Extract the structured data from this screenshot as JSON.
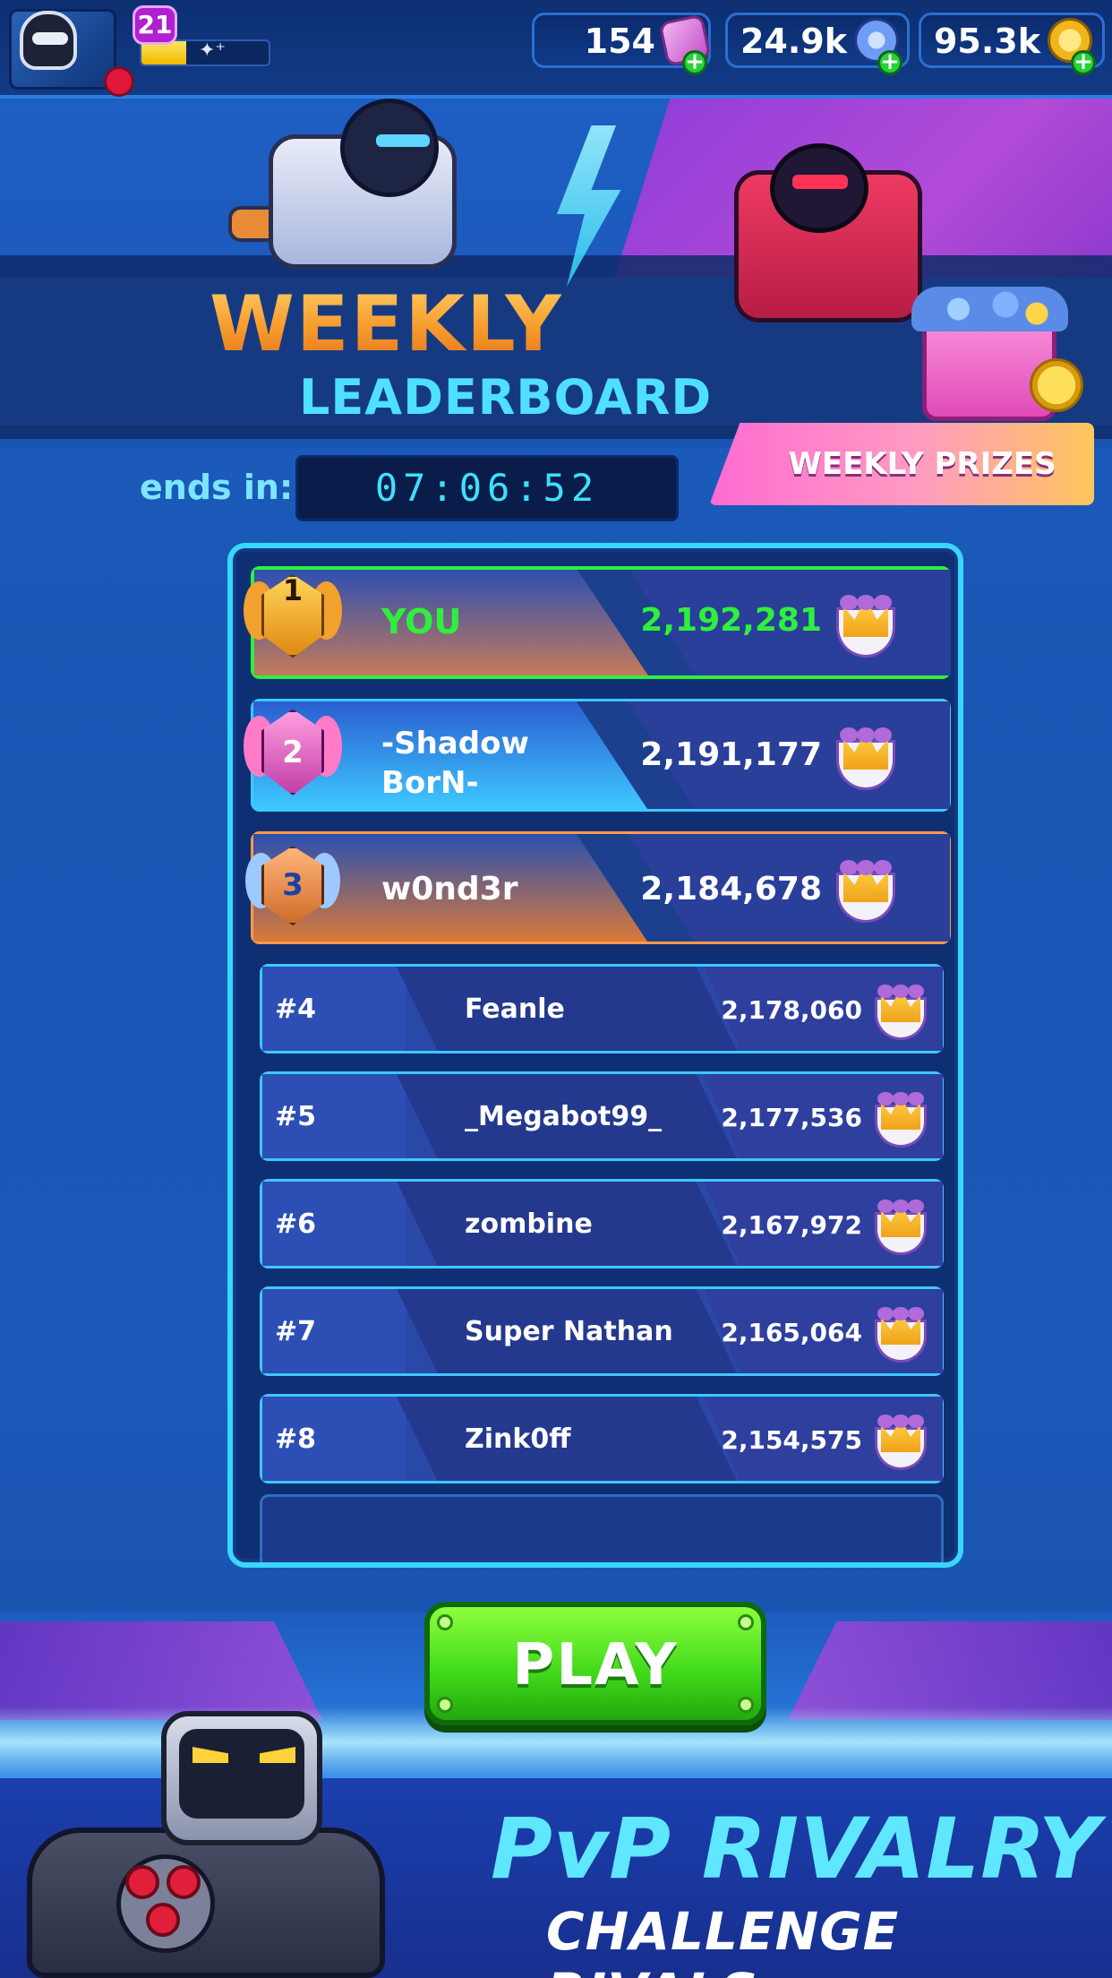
{
  "player": {
    "level": "21"
  },
  "currencies": [
    {
      "id": "cards",
      "value": "154",
      "icon": "card-pack-icon",
      "color": "#e58be0"
    },
    {
      "id": "gems",
      "value": "24.9k",
      "icon": "gem-icon",
      "color": "#7fb2ff"
    },
    {
      "id": "coins",
      "value": "95.3k",
      "icon": "coin-icon",
      "color": "#ffd030"
    }
  ],
  "banner": {
    "title": "WEEKLY",
    "subtitle": "LEADERBOARD"
  },
  "timer": {
    "label": "ends in:",
    "value": "07:06:52"
  },
  "prizes_button": {
    "label": "WEEKLY PRIZES"
  },
  "leaderboard": {
    "top": [
      {
        "rank": "1",
        "name": "YOU",
        "score": "2,192,281"
      },
      {
        "rank": "2",
        "name_line1": "-Shadow",
        "name_line2": "BorN-",
        "score": "2,191,177"
      },
      {
        "rank": "3",
        "name": "w0nd3r",
        "score": "2,184,678"
      }
    ],
    "rows": [
      {
        "rank": "#4",
        "name": "Feanle",
        "score": "2,178,060"
      },
      {
        "rank": "#5",
        "name": "_Megabot99_",
        "score": "2,177,536"
      },
      {
        "rank": "#6",
        "name": "zombine",
        "score": "2,167,972"
      },
      {
        "rank": "#7",
        "name": "Super Nathan",
        "score": "2,165,064"
      },
      {
        "rank": "#8",
        "name": "Zink0ff",
        "score": "2,154,575"
      }
    ]
  },
  "play_button": {
    "label": "PLAY"
  },
  "promo": {
    "line1": "PvP RIVALRY",
    "line2": "CHALLENGE RIVALS"
  },
  "colors": {
    "you_highlight": "#2ef03c",
    "rank2": "#3ec8ff",
    "rank3": "#ff9a4a",
    "accent_cyan": "#39d6ff"
  },
  "xp_fill_fraction": 0.35
}
